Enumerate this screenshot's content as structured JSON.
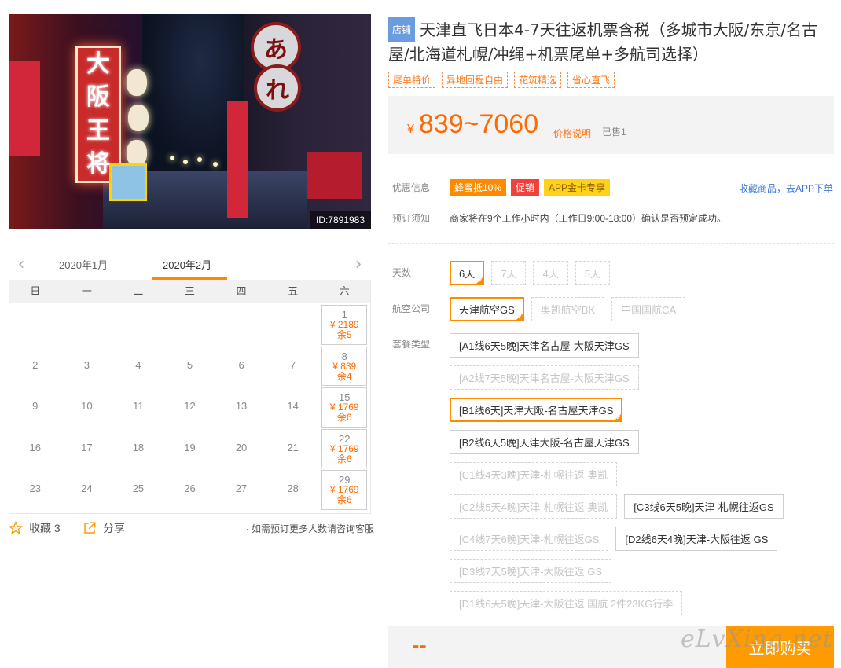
{
  "photo": {
    "id_label": "ID:7891983",
    "sign_chars": [
      "大",
      "阪",
      "王",
      "将"
    ],
    "round_sign_top": "あ",
    "round_sign_bottom": "れ"
  },
  "calendar": {
    "prev_arrow": "‹",
    "next_arrow": "›",
    "months": [
      "2020年1月",
      "2020年2月"
    ],
    "weekdays": [
      "日",
      "一",
      "二",
      "三",
      "四",
      "五",
      "六"
    ],
    "weeks": [
      [
        {
          "d": ""
        },
        {
          "d": ""
        },
        {
          "d": ""
        },
        {
          "d": ""
        },
        {
          "d": ""
        },
        {
          "d": ""
        },
        {
          "d": "1",
          "price": "¥ 2189",
          "left": "余5"
        }
      ],
      [
        {
          "d": "2"
        },
        {
          "d": "3"
        },
        {
          "d": "4"
        },
        {
          "d": "5"
        },
        {
          "d": "6"
        },
        {
          "d": "7"
        },
        {
          "d": "8",
          "price": "¥ 839",
          "left": "余4"
        }
      ],
      [
        {
          "d": "9"
        },
        {
          "d": "10"
        },
        {
          "d": "11"
        },
        {
          "d": "12"
        },
        {
          "d": "13"
        },
        {
          "d": "14"
        },
        {
          "d": "15",
          "price": "¥ 1769",
          "left": "余6"
        }
      ],
      [
        {
          "d": "16"
        },
        {
          "d": "17"
        },
        {
          "d": "18"
        },
        {
          "d": "19"
        },
        {
          "d": "20"
        },
        {
          "d": "21"
        },
        {
          "d": "22",
          "price": "¥ 1769",
          "left": "余6"
        }
      ],
      [
        {
          "d": "23"
        },
        {
          "d": "24"
        },
        {
          "d": "25"
        },
        {
          "d": "26"
        },
        {
          "d": "27"
        },
        {
          "d": "28"
        },
        {
          "d": "29",
          "price": "¥ 1769",
          "left": "余6"
        }
      ]
    ]
  },
  "left_footer": {
    "favorite_label": "收藏 3",
    "share_label": "分享",
    "note": "· 如需预订更多人数请咨询客服"
  },
  "product": {
    "shop_badge": "店铺",
    "title": "天津直飞日本4-7天往返机票含税（多城市大阪/东京/名古屋/北海道札幌/冲绳+机票尾单+多航司选择）",
    "tags": [
      "尾单特价",
      "异地回程自由",
      "花筑精选",
      "省心直飞"
    ],
    "price_currency": "¥",
    "price_range": "839~7060",
    "price_note": "价格说明",
    "sold": "已售1"
  },
  "promo": {
    "label": "优惠信息",
    "badges": [
      "蜂蜜抵10%",
      "促销",
      "APP金卡专享"
    ],
    "app_link": "收藏商品，去APP下单"
  },
  "booking": {
    "label": "预订须知",
    "text": "商家将在9个工作小时内（工作日9:00-18:00）确认是否预定成功。"
  },
  "options": {
    "days_label": "天数",
    "days": [
      "6天",
      "7天",
      "4天",
      "5天"
    ],
    "airline_label": "航空公司",
    "airlines": [
      "天津航空GS",
      "奥凯航空BK",
      "中国国航CA"
    ],
    "package_label": "套餐类型",
    "packages": [
      [
        "[A1线6天5晚]天津名古屋-大阪天津GS"
      ],
      [
        "[A2线7天5晚]天津名古屋-大阪天津GS"
      ],
      [
        "[B1线6天]天津大阪-名古屋天津GS"
      ],
      [
        "[B2线6天5晚]天津大阪-名古屋天津GS"
      ],
      [
        "[C1线4天3晚]天津-札幌往返 奥凯"
      ],
      [
        "[C2线5天4晚]天津-札幌往返 奥凯",
        "[C3线6天5晚]天津-札幌往返GS"
      ],
      [
        "[C4线7天6晚]天津-札幌往返GS",
        "[D2线6天4晚]天津-大阪往返 GS"
      ],
      [
        "[D3线7天5晚]天津-大阪往返 GS"
      ],
      [
        "[D1线6天5晚]天津-大阪往返 国航 2件23KG行李"
      ]
    ],
    "check_mark": "✓"
  },
  "buy": {
    "total": "--",
    "button": "立即购买"
  },
  "watermark": "eLvXing.net",
  "colors": {
    "accent": "#ff8a00",
    "price": "#ff6a00",
    "shop_badge": "#6b9cdf",
    "link": "#3a78d6"
  }
}
